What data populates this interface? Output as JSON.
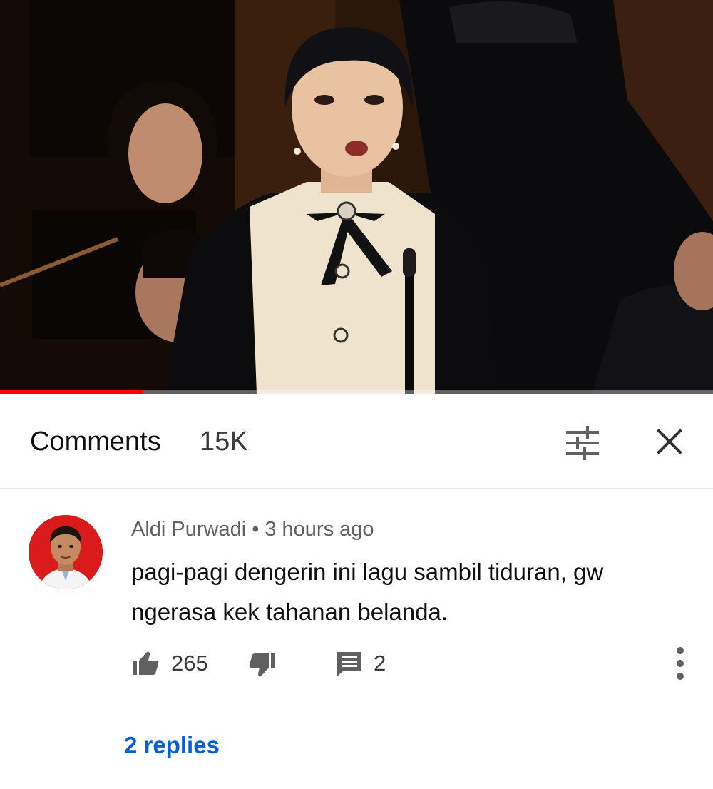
{
  "video": {
    "progress": 0.2
  },
  "comments_header": {
    "title": "Comments",
    "count": "15K",
    "filter_icon": "sort-filter-icon",
    "close_icon": "close-icon"
  },
  "comment": {
    "author": "Aldi Purwadi",
    "separator": "•",
    "time": "3 hours ago",
    "text": "pagi-pagi dengerin ini lagu sambil tiduran, gw ngerasa kek tahanan belanda.",
    "likes": "265",
    "reply_count": "2",
    "replies_label": "2 replies",
    "icons": {
      "like": "thumbs-up-icon",
      "dislike": "thumbs-down-icon",
      "reply": "comment-icon",
      "more": "more-vert-icon"
    }
  },
  "colors": {
    "progress": "#ff0000",
    "link": "#065fd4",
    "secondary_text": "#606060",
    "avatar_bg": "#d91b1b"
  }
}
